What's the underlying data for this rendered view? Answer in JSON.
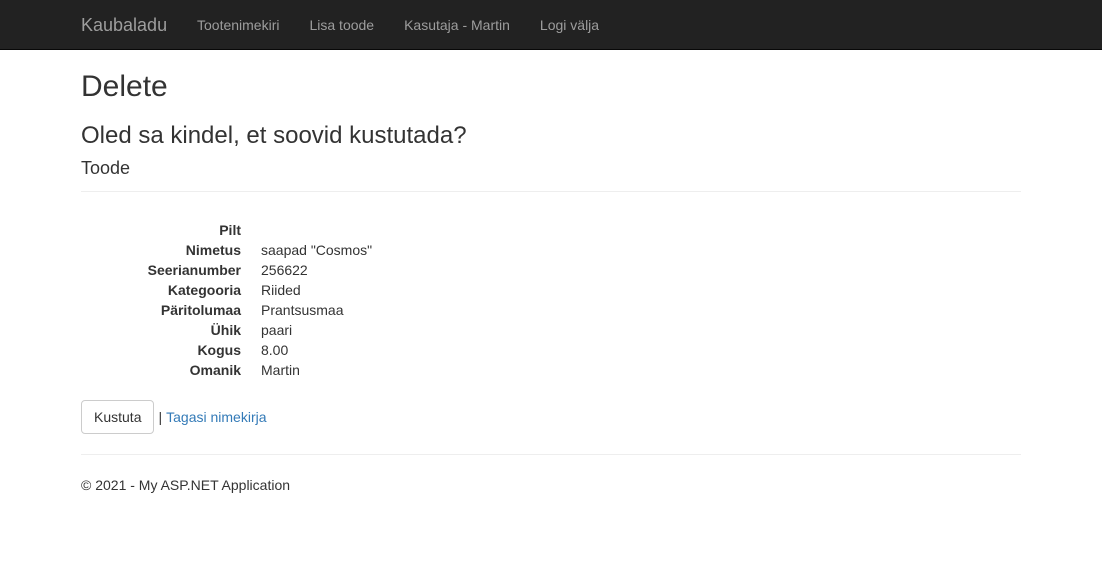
{
  "navbar": {
    "brand": "Kaubaladu",
    "links": [
      {
        "label": "Tootenimekiri"
      },
      {
        "label": "Lisa toode"
      },
      {
        "label": "Kasutaja - Martin"
      },
      {
        "label": "Logi välja"
      }
    ]
  },
  "page": {
    "title": "Delete",
    "question": "Oled sa kindel, et soovid kustutada?",
    "subtitle": "Toode"
  },
  "details": [
    {
      "label": "Pilt",
      "value": ""
    },
    {
      "label": "Nimetus",
      "value": "saapad \"Cosmos\""
    },
    {
      "label": "Seerianumber",
      "value": "256622"
    },
    {
      "label": "Kategooria",
      "value": "Riided"
    },
    {
      "label": "Päritolumaa",
      "value": "Prantsusmaa"
    },
    {
      "label": "Ühik",
      "value": "paari"
    },
    {
      "label": "Kogus",
      "value": "8.00"
    },
    {
      "label": "Omanik",
      "value": "Martin"
    }
  ],
  "actions": {
    "delete_label": "Kustuta",
    "separator": "|",
    "back_label": "Tagasi nimekirja"
  },
  "footer": {
    "text": "© 2021 - My ASP.NET Application"
  }
}
